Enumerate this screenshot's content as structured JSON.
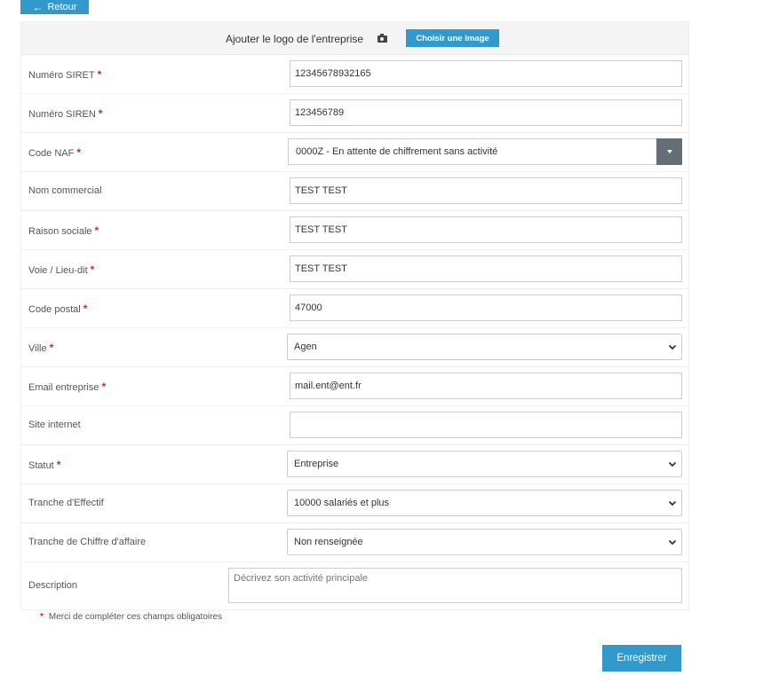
{
  "back_button": {
    "label": "Retour",
    "icon": "arrow-left-icon"
  },
  "logo": {
    "label": "Ajouter le logo de l'entreprise",
    "icon": "camera-icon",
    "button": "Choisir une image"
  },
  "fields": {
    "siret": {
      "label": "Numéro SIRET",
      "required": "*",
      "value": "12345678932165"
    },
    "siren": {
      "label": "Numéro SIREN",
      "required": "*",
      "value": "123456789"
    },
    "naf": {
      "label": "Code NAF",
      "required": "*",
      "value": "0000Z - En attente de chiffrement sans activité"
    },
    "nom_commercial": {
      "label": "Nom commercial",
      "value": "TEST TEST"
    },
    "raison_sociale": {
      "label": "Raison sociale",
      "required": "*",
      "value": "TEST TEST"
    },
    "voie": {
      "label": "Voie / Lieu-dit",
      "required": "*",
      "value": "TEST TEST"
    },
    "code_postal": {
      "label": "Code postal",
      "required": "*",
      "value": "47000"
    },
    "ville": {
      "label": "Ville",
      "required": "*",
      "value": "Agen"
    },
    "email": {
      "label": "Email entreprise",
      "required": "*",
      "value": "mail.ent@ent.fr"
    },
    "site": {
      "label": "Site internet",
      "value": ""
    },
    "statut": {
      "label": "Statut",
      "required": "*",
      "value": "Entreprise"
    },
    "effectif": {
      "label": "Tranche d'Effectif",
      "value": "10000 salariés et plus"
    },
    "chiffre": {
      "label": "Tranche de Chiffre d'affaire",
      "value": "Non renseignée"
    },
    "description": {
      "label": "Description",
      "placeholder": "Décrivez son activité principale"
    }
  },
  "required_note": {
    "star": "*",
    "text": "Merci de compléter ces champs obligatoires"
  },
  "save_button": {
    "label": "Enregistrer"
  },
  "colors": {
    "accent": "#3299cc",
    "required": "#e02020",
    "naf_toggle": "#666e75"
  }
}
